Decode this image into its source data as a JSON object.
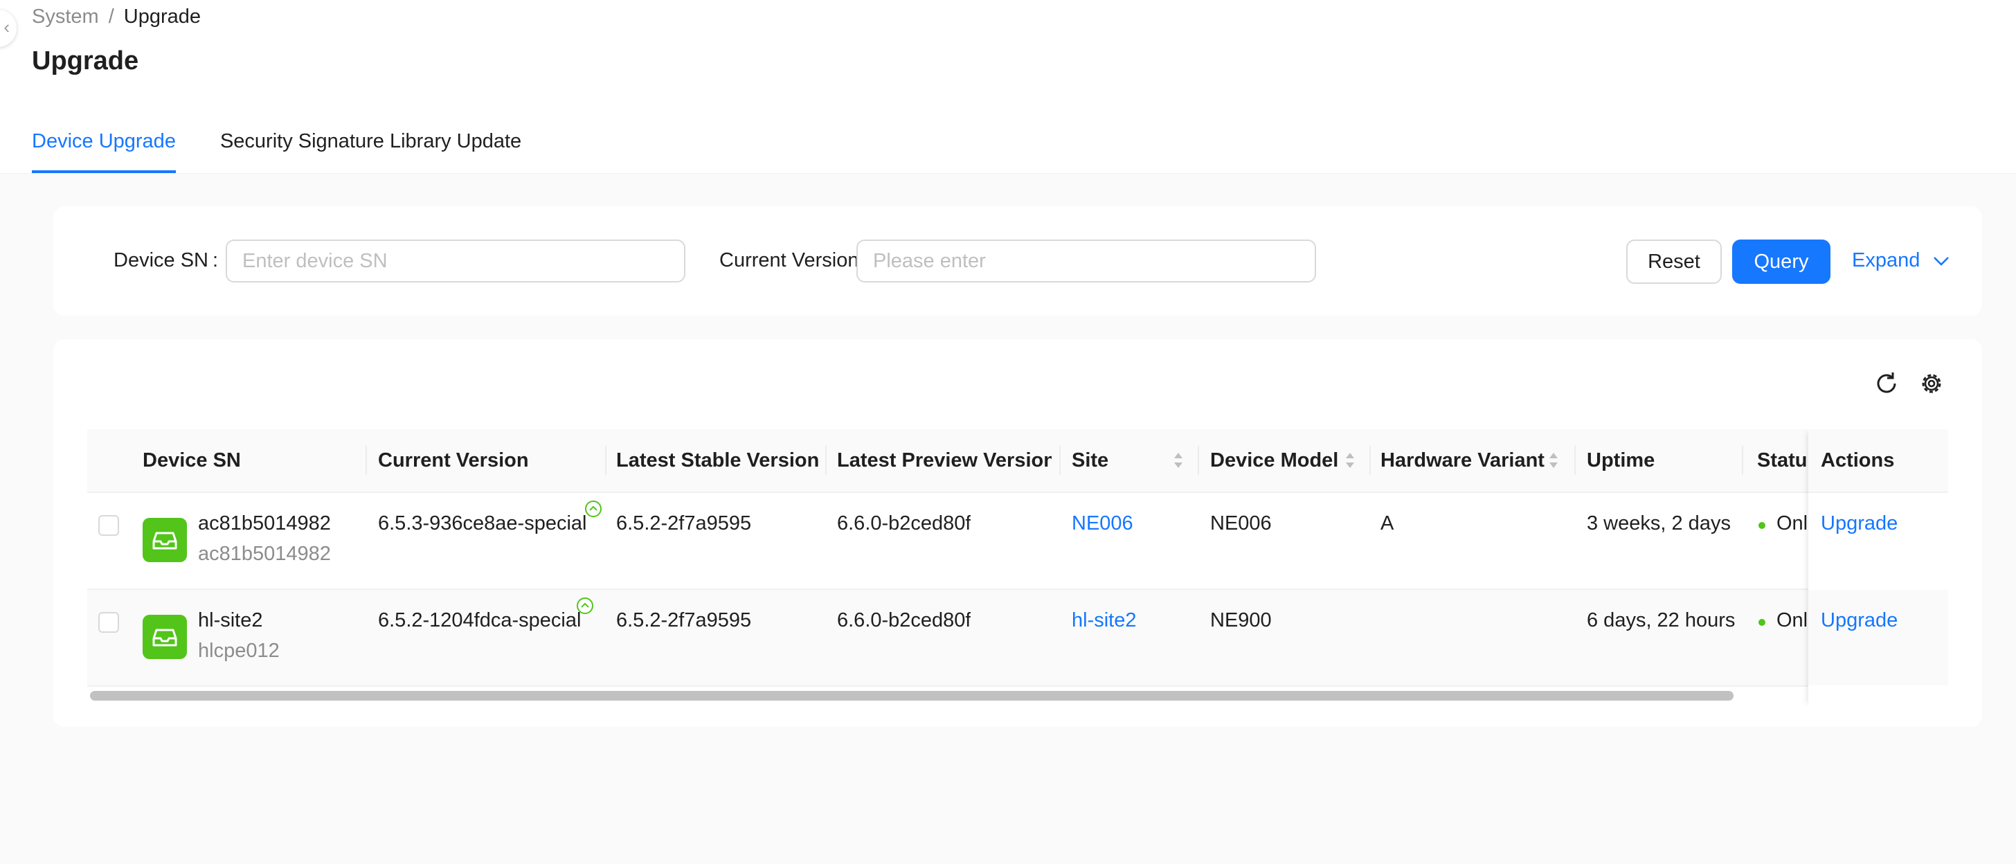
{
  "breadcrumb": {
    "parent": "System",
    "separator": "/",
    "current": "Upgrade"
  },
  "page": {
    "title": "Upgrade"
  },
  "tabs": [
    {
      "label": "Device Upgrade",
      "active": true
    },
    {
      "label": "Security Signature Library Update",
      "active": false
    }
  ],
  "filters": {
    "device_sn": {
      "label": "Device SN",
      "colon": ":",
      "value": "",
      "placeholder": "Enter device SN"
    },
    "current_version": {
      "label": "Current Version",
      "value": "",
      "placeholder": "Please enter"
    },
    "reset_label": "Reset",
    "query_label": "Query",
    "expand_label": "Expand"
  },
  "toolbar": {
    "icons": [
      "refresh-icon",
      "settings-icon"
    ]
  },
  "table": {
    "columns": [
      {
        "label": "Device SN",
        "sortable": false
      },
      {
        "label": "Current Version",
        "sortable": false
      },
      {
        "label": "Latest Stable Version",
        "sortable": false
      },
      {
        "label": "Latest Preview Version",
        "sortable": false
      },
      {
        "label": "Site",
        "sortable": true
      },
      {
        "label": "Device Model",
        "sortable": true
      },
      {
        "label": "Hardware Variant",
        "sortable": true
      },
      {
        "label": "Uptime",
        "sortable": false
      },
      {
        "label": "Status",
        "sortable": false
      },
      {
        "label": "Actions",
        "sortable": false
      }
    ],
    "rows": [
      {
        "name": "ac81b5014982",
        "sn": "ac81b5014982",
        "current_version": "6.5.3-936ce8ae-special",
        "latest_stable": "6.5.2-2f7a9595",
        "latest_preview": "6.6.0-b2ced80f",
        "site": "NE006",
        "model": "NE006",
        "hardware_variant": "A",
        "uptime": "3 weeks, 2 days",
        "status": "Online",
        "action": "Upgrade"
      },
      {
        "name": "hl-site2",
        "sn": "hlcpe012",
        "current_version": "6.5.2-1204fdca-special",
        "latest_stable": "6.5.2-2f7a9595",
        "latest_preview": "6.6.0-b2ced80f",
        "site": "hl-site2",
        "model": "NE900",
        "hardware_variant": "",
        "uptime": "6 days, 22 hours",
        "status": "Online",
        "action": "Upgrade"
      }
    ]
  },
  "colors": {
    "accent": "#1677ff",
    "device_icon": "#52c41a",
    "status_online": "#52c41a"
  }
}
